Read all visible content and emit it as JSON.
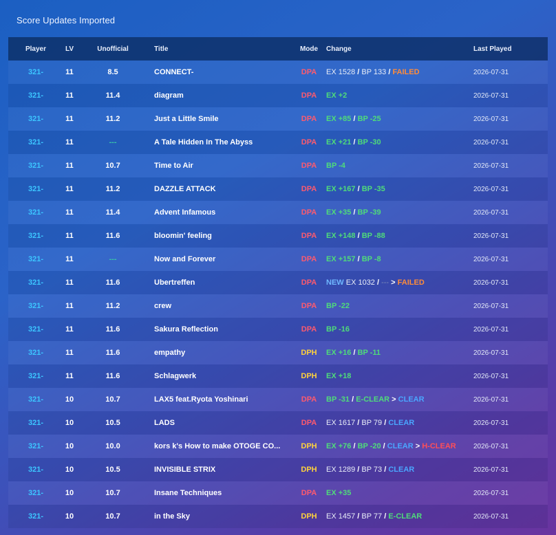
{
  "panel": {
    "title": "Score Updates Imported"
  },
  "columns": {
    "player": "Player",
    "lv": "LV",
    "unofficial": "Unofficial",
    "title": "Title",
    "mode": "Mode",
    "change": "Change",
    "last_played": "Last Played"
  },
  "colors": {
    "player": "#3cc6ff",
    "dpa": "#ff5a6e",
    "dph": "#ffd23c",
    "improve": "#4fdc7a",
    "failed": "#ff8c3a",
    "clear": "#4aa6ff",
    "hard_clear": "#ff4e58"
  },
  "rows": [
    {
      "player": "321-",
      "lv": "11",
      "unofficial": "8.5",
      "title": "CONNECT-",
      "mode": "DPA",
      "change": [
        {
          "text": "EX 1528",
          "style": "plain"
        },
        {
          "text": " / ",
          "style": "sep"
        },
        {
          "text": "BP 133",
          "style": "plain"
        },
        {
          "text": " / ",
          "style": "sep"
        },
        {
          "text": "FAILED",
          "style": "orange"
        }
      ],
      "last_played": "2026-07-31"
    },
    {
      "player": "321-",
      "lv": "11",
      "unofficial": "11.4",
      "title": "diagram",
      "mode": "DPA",
      "change": [
        {
          "text": "EX +2",
          "style": "green"
        }
      ],
      "last_played": "2026-07-31"
    },
    {
      "player": "321-",
      "lv": "11",
      "unofficial": "11.2",
      "title": "Just a Little Smile",
      "mode": "DPA",
      "change": [
        {
          "text": "EX +85",
          "style": "green"
        },
        {
          "text": " / ",
          "style": "sep"
        },
        {
          "text": "BP -25",
          "style": "green"
        }
      ],
      "last_played": "2026-07-31"
    },
    {
      "player": "321-",
      "lv": "11",
      "unofficial": "---",
      "title": "A Tale Hidden In The Abyss",
      "mode": "DPA",
      "change": [
        {
          "text": "EX +21",
          "style": "green"
        },
        {
          "text": " / ",
          "style": "sep"
        },
        {
          "text": "BP -30",
          "style": "green"
        }
      ],
      "last_played": "2026-07-31"
    },
    {
      "player": "321-",
      "lv": "11",
      "unofficial": "10.7",
      "title": "Time to Air",
      "mode": "DPA",
      "change": [
        {
          "text": "BP -4",
          "style": "green"
        }
      ],
      "last_played": "2026-07-31"
    },
    {
      "player": "321-",
      "lv": "11",
      "unofficial": "11.2",
      "title": "DAZZLE ATTACK",
      "mode": "DPA",
      "change": [
        {
          "text": "EX +167",
          "style": "green"
        },
        {
          "text": " / ",
          "style": "sep"
        },
        {
          "text": "BP -35",
          "style": "green"
        }
      ],
      "last_played": "2026-07-31"
    },
    {
      "player": "321-",
      "lv": "11",
      "unofficial": "11.4",
      "title": "Advent Infamous",
      "mode": "DPA",
      "change": [
        {
          "text": "EX +35",
          "style": "green"
        },
        {
          "text": " / ",
          "style": "sep"
        },
        {
          "text": "BP -39",
          "style": "green"
        }
      ],
      "last_played": "2026-07-31"
    },
    {
      "player": "321-",
      "lv": "11",
      "unofficial": "11.6",
      "title": "bloomin' feeling",
      "mode": "DPA",
      "change": [
        {
          "text": "EX +148",
          "style": "green"
        },
        {
          "text": " / ",
          "style": "sep"
        },
        {
          "text": "BP -88",
          "style": "green"
        }
      ],
      "last_played": "2026-07-31"
    },
    {
      "player": "321-",
      "lv": "11",
      "unofficial": "---",
      "title": "Now and Forever",
      "mode": "DPA",
      "change": [
        {
          "text": "EX +157",
          "style": "green"
        },
        {
          "text": " / ",
          "style": "sep"
        },
        {
          "text": "BP -8",
          "style": "green"
        }
      ],
      "last_played": "2026-07-31"
    },
    {
      "player": "321-",
      "lv": "11",
      "unofficial": "11.6",
      "title": "Ubertreffen",
      "mode": "DPA",
      "change": [
        {
          "text": "NEW",
          "style": "newblue"
        },
        {
          "text": " EX 1032",
          "style": "plain"
        },
        {
          "text": " / ",
          "style": "sep"
        },
        {
          "text": "---",
          "style": "dim"
        },
        {
          "text": " > ",
          "style": "sep"
        },
        {
          "text": "FAILED",
          "style": "orange"
        }
      ],
      "last_played": "2026-07-31"
    },
    {
      "player": "321-",
      "lv": "11",
      "unofficial": "11.2",
      "title": "crew",
      "mode": "DPA",
      "change": [
        {
          "text": "BP -22",
          "style": "green"
        }
      ],
      "last_played": "2026-07-31"
    },
    {
      "player": "321-",
      "lv": "11",
      "unofficial": "11.6",
      "title": "Sakura Reflection",
      "mode": "DPA",
      "change": [
        {
          "text": "BP -16",
          "style": "green"
        }
      ],
      "last_played": "2026-07-31"
    },
    {
      "player": "321-",
      "lv": "11",
      "unofficial": "11.6",
      "title": "empathy",
      "mode": "DPH",
      "change": [
        {
          "text": "EX +16",
          "style": "green"
        },
        {
          "text": " / ",
          "style": "sep"
        },
        {
          "text": "BP -11",
          "style": "green"
        }
      ],
      "last_played": "2026-07-31"
    },
    {
      "player": "321-",
      "lv": "11",
      "unofficial": "11.6",
      "title": "Schlagwerk",
      "mode": "DPH",
      "change": [
        {
          "text": "EX +18",
          "style": "green"
        }
      ],
      "last_played": "2026-07-31"
    },
    {
      "player": "321-",
      "lv": "10",
      "unofficial": "10.7",
      "title": "LAX5 feat.Ryota Yoshinari",
      "mode": "DPA",
      "change": [
        {
          "text": "BP -31",
          "style": "green"
        },
        {
          "text": " / ",
          "style": "sep"
        },
        {
          "text": "E-CLEAR",
          "style": "green"
        },
        {
          "text": " > ",
          "style": "sep"
        },
        {
          "text": "CLEAR",
          "style": "blue"
        }
      ],
      "last_played": "2026-07-31"
    },
    {
      "player": "321-",
      "lv": "10",
      "unofficial": "10.5",
      "title": "LADS",
      "mode": "DPA",
      "change": [
        {
          "text": "EX 1617",
          "style": "plain"
        },
        {
          "text": " / ",
          "style": "sep"
        },
        {
          "text": "BP 79",
          "style": "plain"
        },
        {
          "text": " / ",
          "style": "sep"
        },
        {
          "text": "CLEAR",
          "style": "blue"
        }
      ],
      "last_played": "2026-07-31"
    },
    {
      "player": "321-",
      "lv": "10",
      "unofficial": "10.0",
      "title": "kors k's How to make OTOGE CO...",
      "mode": "DPH",
      "change": [
        {
          "text": "EX +76",
          "style": "green"
        },
        {
          "text": " / ",
          "style": "sep"
        },
        {
          "text": "BP -20",
          "style": "green"
        },
        {
          "text": " / ",
          "style": "sep"
        },
        {
          "text": "CLEAR",
          "style": "blue"
        },
        {
          "text": " > ",
          "style": "sep"
        },
        {
          "text": "H-CLEAR",
          "style": "red"
        }
      ],
      "last_played": "2026-07-31"
    },
    {
      "player": "321-",
      "lv": "10",
      "unofficial": "10.5",
      "title": "INVISIBLE STRIX",
      "mode": "DPH",
      "change": [
        {
          "text": "EX 1289",
          "style": "plain"
        },
        {
          "text": " / ",
          "style": "sep"
        },
        {
          "text": "BP 73",
          "style": "plain"
        },
        {
          "text": " / ",
          "style": "sep"
        },
        {
          "text": "CLEAR",
          "style": "blue"
        }
      ],
      "last_played": "2026-07-31"
    },
    {
      "player": "321-",
      "lv": "10",
      "unofficial": "10.7",
      "title": "Insane Techniques",
      "mode": "DPA",
      "change": [
        {
          "text": "EX +35",
          "style": "green"
        }
      ],
      "last_played": "2026-07-31"
    },
    {
      "player": "321-",
      "lv": "10",
      "unofficial": "10.7",
      "title": "in the Sky",
      "mode": "DPH",
      "change": [
        {
          "text": "EX 1457",
          "style": "plain"
        },
        {
          "text": " / ",
          "style": "sep"
        },
        {
          "text": "BP 77",
          "style": "plain"
        },
        {
          "text": " / ",
          "style": "sep"
        },
        {
          "text": "E-CLEAR",
          "style": "green"
        }
      ],
      "last_played": "2026-07-31"
    }
  ]
}
